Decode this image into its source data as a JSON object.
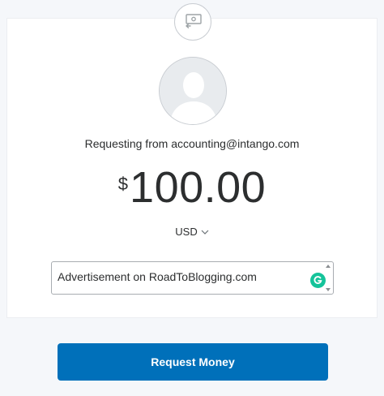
{
  "header": {
    "icon": "money-request-icon"
  },
  "recipient": {
    "avatar_icon": "default-avatar-icon",
    "requesting_text": "Requesting from accounting@intango.com"
  },
  "amount": {
    "symbol": "$",
    "value": "100.00",
    "currency": "USD",
    "currency_icon": "chevron-down-icon"
  },
  "note": {
    "value": "Advertisement on RoadToBlogging.com",
    "extension_icon": "grammarly-icon"
  },
  "actions": {
    "submit_label": "Request Money"
  },
  "colors": {
    "primary": "#0070ba",
    "background": "#f5f7fa",
    "grammarly": "#15c39a"
  }
}
